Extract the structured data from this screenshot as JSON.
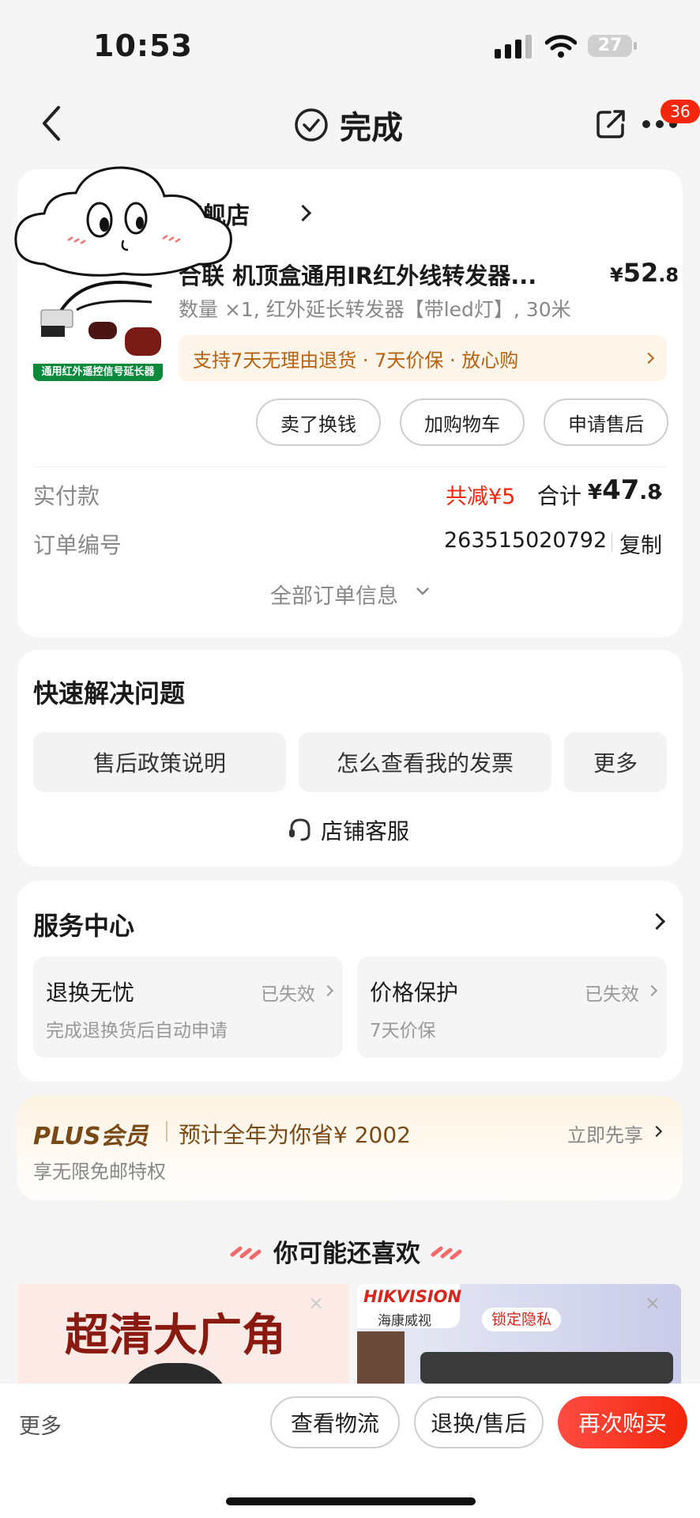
{
  "status_bar": {
    "time": "10:53",
    "battery": "27"
  },
  "header": {
    "title": "完成",
    "badge_count": "36",
    "icons": [
      "back-icon",
      "check-circle-icon",
      "share-icon",
      "more-icon"
    ]
  },
  "order": {
    "store_name": "旗舰店",
    "product_title": "合联 机顶盒通用IR红外线转发器...",
    "product_image_text": "通用红外遥控信号延长器",
    "price_prefix": "¥",
    "price_int": "52",
    "price_dec": ".8",
    "spec": "数量 ×1, 红外延长转发器【带led灯】, 30米",
    "promo": "支持7天无理由退货 · 7天价保 · 放心购",
    "buttons": {
      "sell": "卖了换钱",
      "add_cart": "加购物车",
      "after_sale": "申请售后"
    },
    "paid_label": "实付款",
    "discount": "共减¥5",
    "total_label": "合计",
    "total_prefix": "¥",
    "total_int": "47",
    "total_dec": ".8",
    "order_no_label": "订单编号",
    "order_no": "263515020792",
    "copy": "复制",
    "all_info": "全部订单信息"
  },
  "quick": {
    "title": "快速解决问题",
    "buttons": [
      "售后政策说明",
      "怎么查看我的发票",
      "更多"
    ],
    "service": "店铺客服"
  },
  "service_center": {
    "title": "服务中心",
    "items": [
      {
        "title": "退换无忧",
        "status": "已失效",
        "desc": "完成退换货后自动申请"
      },
      {
        "title": "价格保护",
        "status": "已失效",
        "desc": "7天价保"
      }
    ]
  },
  "plus": {
    "brand": "PLUS会员",
    "text": "预计全年为你省¥ 2002",
    "link": "立即先享",
    "sub": "享无限免邮特权"
  },
  "recommend": {
    "title": "你可能还喜欢",
    "item1": {
      "text": "超清大广角"
    },
    "item2": {
      "brand": "HIKVISION",
      "brand_cn": "海康威视",
      "tag": "锁定隐私"
    }
  },
  "bottom_bar": {
    "more": "更多",
    "logistics": "查看物流",
    "return": "退换/售后",
    "rebuy": "再次购买"
  },
  "colors": {
    "accent": "#f2270c",
    "rebuy_start": "#ff4c43",
    "rebuy_end": "#f2270c",
    "plus_brown": "#7a4a16",
    "promo_text": "#b8620f",
    "promo_bg": "#fdf5ea"
  }
}
